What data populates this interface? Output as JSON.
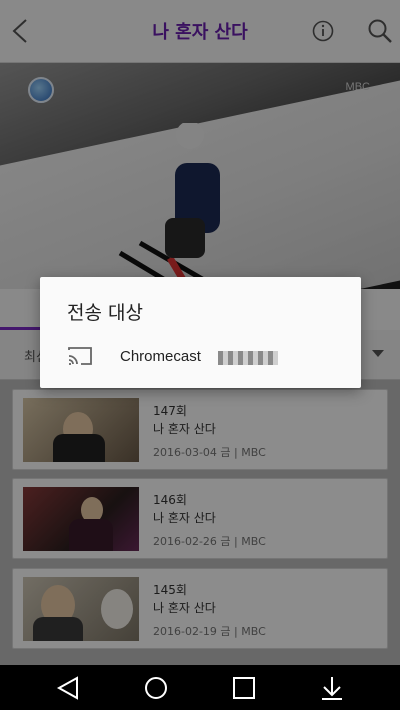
{
  "header": {
    "title": "나 혼자 산다",
    "back_icon": "chevron-left-icon",
    "info_icon": "info-icon",
    "search_icon": "search-icon",
    "accent_color": "#6a1fb0"
  },
  "video": {
    "channel_badge_icon": "channel-logo-icon",
    "watermark": "MBC"
  },
  "sort": {
    "label": "최신",
    "dropdown_icon": "triangle-down-icon"
  },
  "episodes": [
    {
      "number": "147회",
      "show": "나 혼자 산다",
      "meta": "2016-03-04 금 | MBC"
    },
    {
      "number": "146회",
      "show": "나 혼자 산다",
      "meta": "2016-02-26 금 | MBC"
    },
    {
      "number": "145회",
      "show": "나 혼자 산다",
      "meta": "2016-02-19 금 | MBC"
    }
  ],
  "cast_dialog": {
    "title": "전송 대상",
    "devices": [
      {
        "name": "Chromecast",
        "icon": "cast-icon"
      }
    ]
  },
  "navbar": {
    "back_icon": "nav-back-icon",
    "home_icon": "nav-home-icon",
    "recents_icon": "nav-recents-icon",
    "download_icon": "nav-download-icon"
  }
}
